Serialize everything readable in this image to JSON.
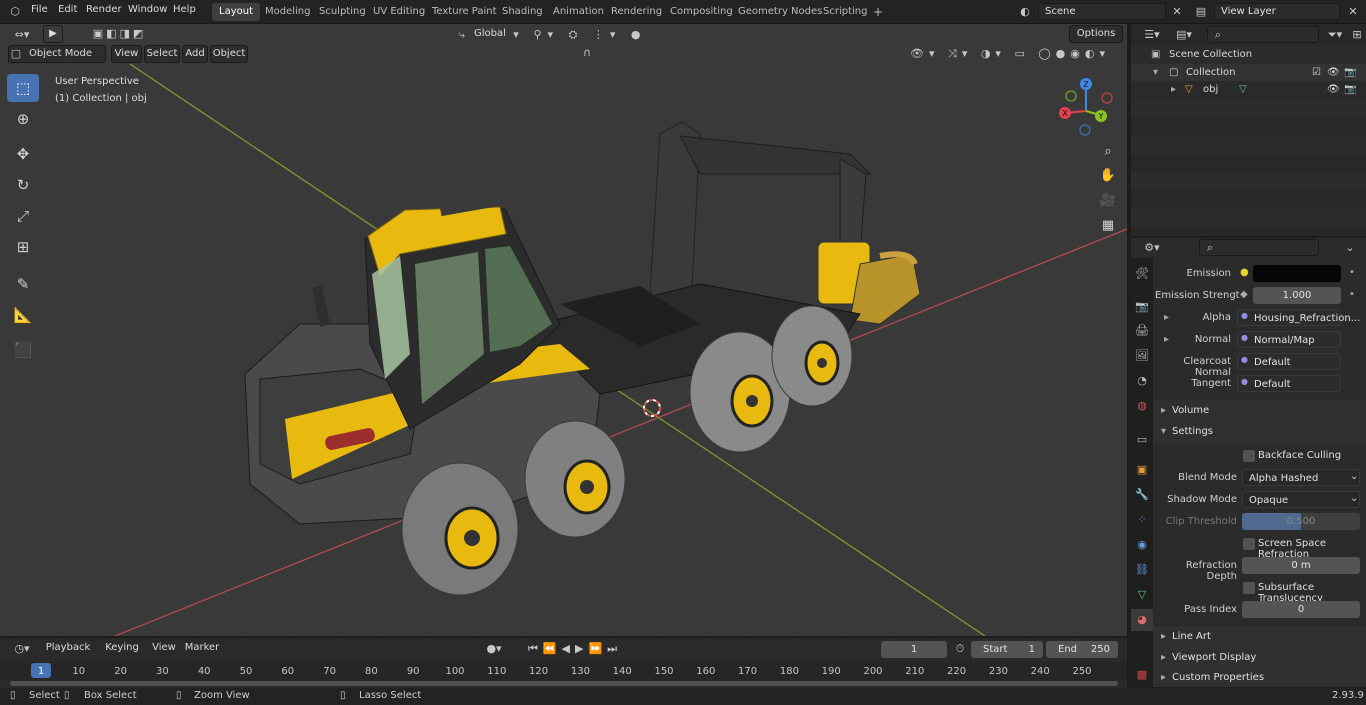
{
  "topbar": {
    "menus": [
      "File",
      "Edit",
      "Render",
      "Window",
      "Help"
    ],
    "workspaces": [
      "Layout",
      "Modeling",
      "Sculpting",
      "UV Editing",
      "Texture Paint",
      "Shading",
      "Animation",
      "Rendering",
      "Compositing",
      "Geometry Nodes",
      "Scripting"
    ],
    "active_workspace": "Layout",
    "add_workspace": "+",
    "scene": "Scene",
    "view_layer": "View Layer"
  },
  "viewport": {
    "mode": "Object Mode",
    "menus": [
      "View",
      "Select",
      "Add",
      "Object"
    ],
    "transform_orientation": "Global",
    "options_label": "Options",
    "overlay_line1": "User Perspective",
    "overlay_line2": "(1) Collection | obj",
    "gizmo": {
      "z": "Z",
      "y": "Y",
      "x": "X"
    }
  },
  "outliner": {
    "scene_collection": "Scene Collection",
    "collection": "Collection",
    "object": "obj"
  },
  "properties": {
    "rows": [
      {
        "label": "Emission",
        "value": ""
      },
      {
        "label": "Emission Strengt",
        "value": "1.000"
      },
      {
        "label": "Alpha",
        "value": "Housing_Refraction..."
      },
      {
        "label": "Normal",
        "value": "Normal/Map"
      },
      {
        "label": "Clearcoat Normal",
        "value": "Default"
      },
      {
        "label": "Tangent",
        "value": "Default"
      }
    ],
    "volume": "Volume",
    "settings": "Settings",
    "backface_culling": "Backface Culling",
    "blend_mode_label": "Blend Mode",
    "blend_mode": "Alpha Hashed",
    "shadow_mode_label": "Shadow Mode",
    "shadow_mode": "Opaque",
    "clip_threshold_label": "Clip Threshold",
    "clip_threshold": "0.500",
    "clip_threshold_fraction": 0.5,
    "ssr": "Screen Space Refraction",
    "refraction_depth_label": "Refraction Depth",
    "refraction_depth": "0 m",
    "subsurface": "Subsurface Translucency",
    "pass_index_label": "Pass Index",
    "pass_index": "0",
    "line_art": "Line Art",
    "viewport_display": "Viewport Display",
    "custom_properties": "Custom Properties"
  },
  "timeline": {
    "menus": [
      "Playback",
      "Keying",
      "View",
      "Marker"
    ],
    "current_frame": "1",
    "start_label": "Start",
    "start": "1",
    "end_label": "End",
    "end": "250",
    "ticks": [
      "1",
      "10",
      "20",
      "30",
      "40",
      "50",
      "60",
      "70",
      "80",
      "90",
      "100",
      "110",
      "120",
      "130",
      "140",
      "150",
      "160",
      "170",
      "180",
      "190",
      "200",
      "210",
      "220",
      "230",
      "240",
      "250"
    ]
  },
  "statusbar": {
    "select": "Select",
    "box_select": "Box Select",
    "zoom_view": "Zoom View",
    "lasso_select": "Lasso Select",
    "version": "2.93.9"
  },
  "colors": {
    "accent": "#4772b3",
    "viewport_bg": "#393939",
    "machine_yellow": "#e8b90e",
    "x_axis": "#e3414d",
    "y_axis": "#8ac421",
    "z_axis": "#3f8ae8"
  }
}
